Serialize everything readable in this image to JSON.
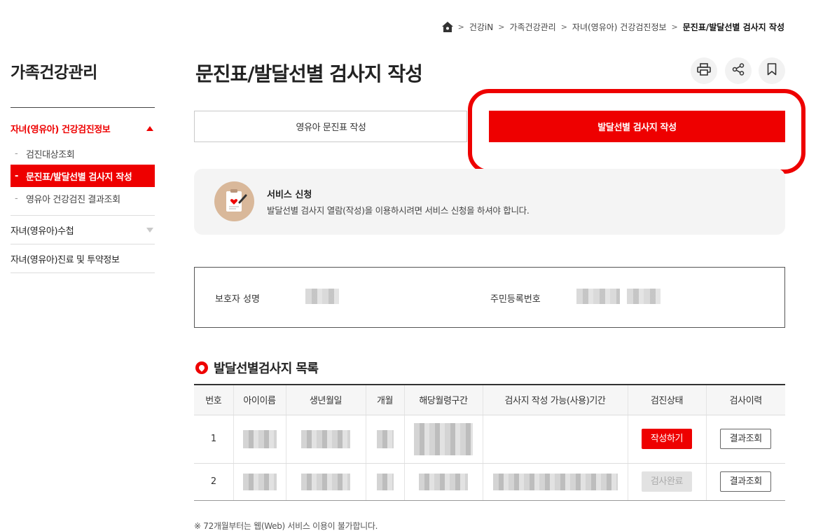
{
  "breadcrumb": {
    "items": [
      "건강iN",
      "가족건강관리",
      "자녀(영유아) 건강검진정보",
      "문진표/발달선별 검사지 작성"
    ]
  },
  "sidebar": {
    "title": "가족건강관리",
    "groups": [
      {
        "label": "자녀(영유아) 건강검진정보",
        "expanded": true,
        "items": [
          {
            "label": "검진대상조회"
          },
          {
            "label": "문진표/발달선별 검사지 작성",
            "active": true
          },
          {
            "label": "영유아 건강검진 결과조회"
          }
        ]
      },
      {
        "label": "자녀(영유아)수첩",
        "expanded": false
      },
      {
        "label": "자녀(영유아)진료 및 투약정보"
      }
    ]
  },
  "main": {
    "title": "문진표/발달선별 검사지 작성",
    "tools": [
      "print-icon",
      "share-icon",
      "bookmark-icon"
    ],
    "tabs": [
      {
        "label": "영유아 문진표 작성",
        "active": false
      },
      {
        "label": "발달선별 검사지 작성",
        "active": true
      }
    ],
    "notice": {
      "title": "서비스 신청",
      "text": "발달선별 검사지 열람(작성)을 이용하시려면 서비스 신청을 하셔야 합니다."
    },
    "guardian": {
      "name_label": "보호자 성명",
      "rrn_label": "주민등록번호"
    },
    "list": {
      "title": "발달선별검사지 목록",
      "columns": [
        "번호",
        "아이이름",
        "생년월일",
        "개월",
        "해당월령구간",
        "검사지 작성 가능(사용)기간",
        "검진상태",
        "검사이력"
      ],
      "rows": [
        {
          "no": "1",
          "status_button": "작성하기",
          "history_button": "결과조회"
        },
        {
          "no": "2",
          "status_button": "검사완료",
          "history_button": "결과조회"
        }
      ]
    },
    "footnote": "※ 72개월부터는 웹(Web) 서비스 이용이 불가합니다."
  },
  "colors": {
    "accent": "#ee0000",
    "notice_bg": "#f4f4f4",
    "disabled_button": "#e2e2e2"
  }
}
